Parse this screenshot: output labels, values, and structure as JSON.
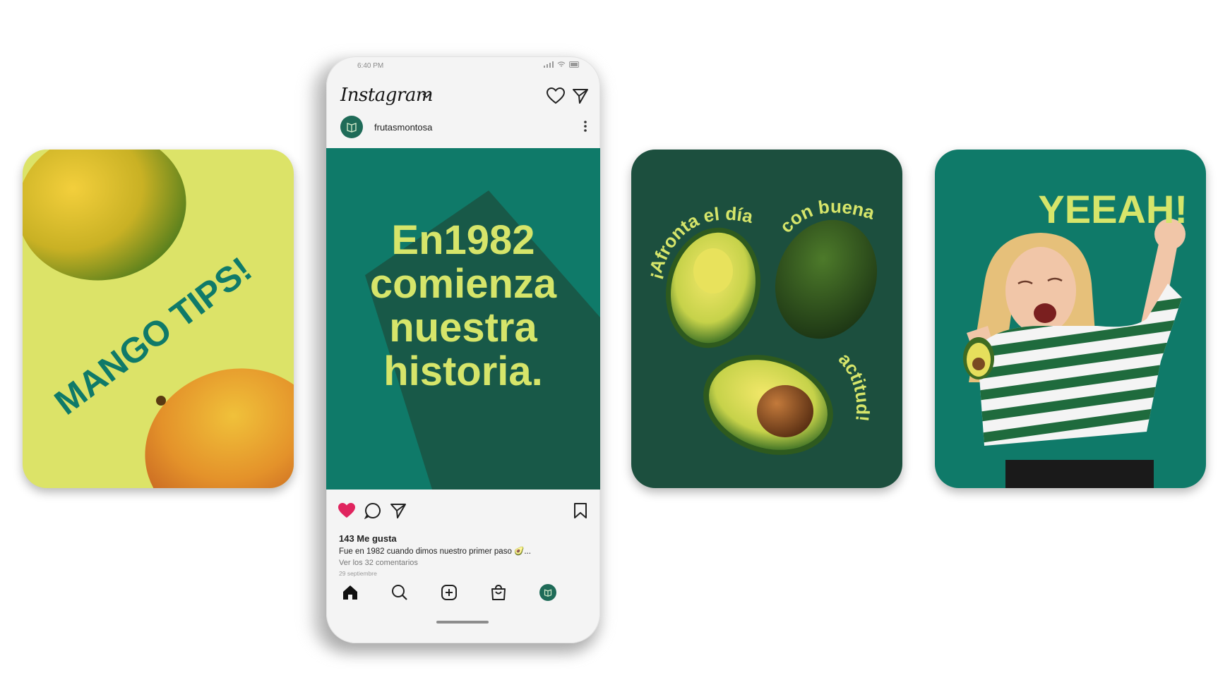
{
  "colors": {
    "accent": "#d6e56a",
    "green_dark": "#1c4f3e",
    "green_teal": "#0f7a69",
    "mango_bg": "#dce368",
    "like_red": "#e0245e"
  },
  "mango_card": {
    "title": "MANGO TIPS!"
  },
  "phone": {
    "status": {
      "time": "6:40 PM"
    },
    "app": {
      "logo": "Instagram"
    },
    "post": {
      "username": "frutasmontosa",
      "headline": [
        "En1982",
        "comienza",
        "nuestra",
        "historia."
      ],
      "likes": "143 Me gusta",
      "caption": "Fue en 1982 cuando dimos nuestro primer paso 🥑...",
      "comments": "Ver los 32 comentarios",
      "date": "29 septiembre"
    },
    "icons": [
      "heart-icon",
      "send-icon",
      "more-icon",
      "like-icon",
      "comment-icon",
      "share-icon",
      "bookmark-icon",
      "home-icon",
      "search-icon",
      "add-icon",
      "shop-icon",
      "profile-icon"
    ]
  },
  "avocado_card": {
    "arc_left": "¡Afronta el día",
    "arc_right": "con buena",
    "arc_bottom": "actitud!"
  },
  "yeah_card": {
    "title": "YEEAH!"
  }
}
